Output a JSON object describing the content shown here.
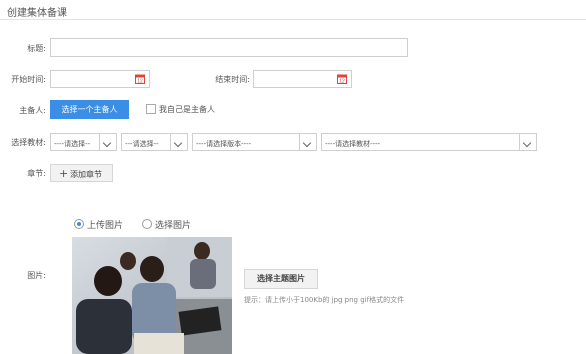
{
  "page_title": "创建集体备课",
  "form": {
    "title_label": "标题:",
    "title_value": "",
    "start_label": "开始时间:",
    "start_value": "",
    "end_label": "结束时间:",
    "end_value": "",
    "preparer_label": "主备人:",
    "choose_preparer_button": "选择一个主备人",
    "self_preparer_checkbox": "我自己是主备人",
    "textbook_label": "选择教材:",
    "selects": [
      "----请选择--",
      "---请选择--",
      "----请选择版本----",
      "----请选择教材----"
    ],
    "chapter_label": "章节:",
    "add_chapter_button": "添加章节",
    "add_icon": "+",
    "image_label": "图片:",
    "radio_upload": "上传图片",
    "radio_select": "选择图片",
    "radio_selected": "upload",
    "choose_theme_image_button": "选择主题图片",
    "hint": "提示：请上传小于100Kb的 jpg png gif格式的文件"
  },
  "colors": {
    "accent": "#3a8ee6",
    "date_icon": "#d9463a"
  }
}
